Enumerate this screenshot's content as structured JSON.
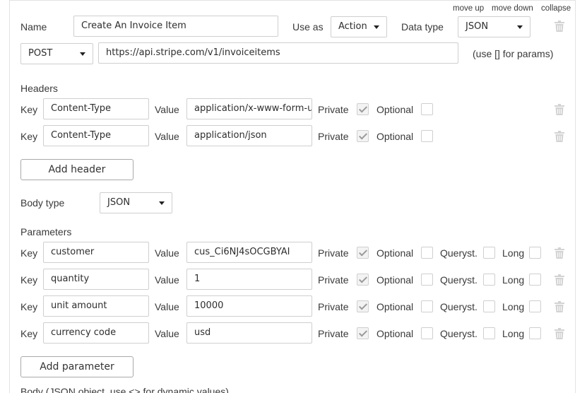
{
  "top_links": {
    "move_up": "move up",
    "move_down": "move down",
    "collapse": "collapse"
  },
  "call": {
    "name_label": "Name",
    "name_value": "Create An Invoice Item",
    "use_as_label": "Use as",
    "use_as_value": "Action",
    "data_type_label": "Data type",
    "data_type_value": "JSON",
    "method_value": "POST",
    "url_value": "https://api.stripe.com/v1/invoiceitems",
    "params_hint": "(use [] for params)"
  },
  "headers": {
    "title": "Headers",
    "key_label": "Key",
    "value_label": "Value",
    "private_label": "Private",
    "optional_label": "Optional",
    "items": [
      {
        "key": "Content-Type",
        "value": "application/x-www-form-urlencoded",
        "private": true,
        "optional": false
      },
      {
        "key": "Content-Type",
        "value": "application/json",
        "private": true,
        "optional": false
      }
    ],
    "add_button": "Add header"
  },
  "body_type": {
    "label": "Body type",
    "value": "JSON"
  },
  "parameters": {
    "title": "Parameters",
    "key_label": "Key",
    "value_label": "Value",
    "private_label": "Private",
    "optional_label": "Optional",
    "queryst_label": "Queryst.",
    "long_label": "Long",
    "items": [
      {
        "key": "customer",
        "value": "cus_Ci6NJ4sOCGBYAI",
        "private": true,
        "optional": false,
        "queryst": false,
        "long": false
      },
      {
        "key": "quantity",
        "value": "1",
        "private": true,
        "optional": false,
        "queryst": false,
        "long": false
      },
      {
        "key": "unit amount",
        "value": "10000",
        "private": true,
        "optional": false,
        "queryst": false,
        "long": false
      },
      {
        "key": "currency code",
        "value": "usd",
        "private": true,
        "optional": false,
        "queryst": false,
        "long": false
      }
    ],
    "add_button": "Add parameter"
  },
  "body_hint": "Body (JSON object, use <> for dynamic values)",
  "icons": {
    "delete": "trash-icon",
    "dropdown": "chevron-down-icon",
    "checkbox_checked": "check-icon"
  }
}
